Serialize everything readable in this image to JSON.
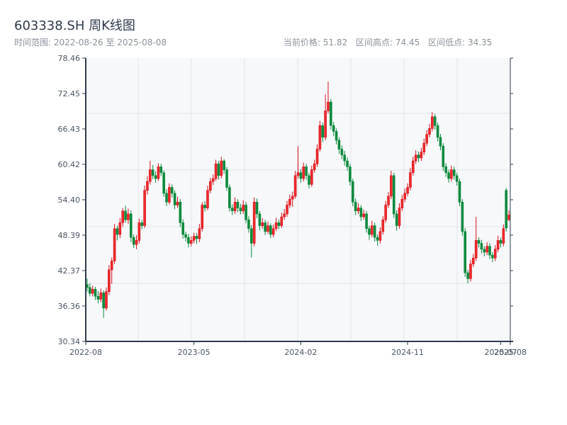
{
  "header": {
    "title": "603338.SH 周K线图",
    "range_label": "时间范围: 2022-08-26 至 2025-08-08",
    "current_price": "当前价格: 51.82",
    "range_high": "区间高点: 74.45",
    "range_low": "区间低点: 34.35"
  },
  "chart_data": {
    "type": "candlestick",
    "title": "603338.SH 周K线图",
    "ylim": [
      30.34,
      78.46
    ],
    "y_ticks": [
      "78.46",
      "72.45",
      "66.43",
      "60.42",
      "54.40",
      "48.39",
      "42.37",
      "36.36",
      "30.34"
    ],
    "x_ticks": [
      {
        "label": "2022-08",
        "date": "2022-08-26"
      },
      {
        "label": "2023-05",
        "date": "2023-05-26"
      },
      {
        "label": "2024-02",
        "date": "2024-02-23"
      },
      {
        "label": "2024-11",
        "date": "2024-11-22"
      },
      {
        "label": "2025-07",
        "date": "2025-07-18"
      },
      {
        "label": "2025-08",
        "date": "2025-08-08"
      }
    ],
    "grid": true,
    "colors": {
      "up": "#d7101c",
      "down": "#0c8a3c",
      "background": "#f6f8fa",
      "axis": "#2f3b4c",
      "grid": "#e2e5ea"
    },
    "columns": [
      "date",
      "open",
      "high",
      "low",
      "close"
    ],
    "candles": [
      [
        "2022-08-26",
        40.0,
        41.0,
        38.8,
        39.5
      ],
      [
        "2022-09-02",
        39.5,
        40.2,
        38.0,
        38.5
      ],
      [
        "2022-09-09",
        38.5,
        39.8,
        38.0,
        39.2
      ],
      [
        "2022-09-16",
        39.2,
        39.6,
        37.4,
        38.0
      ],
      [
        "2022-09-23",
        38.0,
        38.9,
        36.8,
        37.5
      ],
      [
        "2022-09-30",
        37.5,
        39.3,
        37.0,
        38.6
      ],
      [
        "2022-10-07",
        38.6,
        39.0,
        34.35,
        36.0
      ],
      [
        "2022-10-14",
        36.0,
        39.5,
        35.6,
        38.8
      ],
      [
        "2022-10-21",
        38.8,
        43.3,
        38.2,
        42.5
      ],
      [
        "2022-10-28",
        42.5,
        44.6,
        40.1,
        44.0
      ],
      [
        "2022-11-04",
        44.0,
        50.3,
        43.5,
        49.5
      ],
      [
        "2022-11-11",
        49.5,
        50.0,
        47.5,
        48.5
      ],
      [
        "2022-11-18",
        48.5,
        51.3,
        47.9,
        50.5
      ],
      [
        "2022-11-25",
        50.5,
        53.0,
        49.8,
        52.5
      ],
      [
        "2022-12-02",
        52.5,
        53.4,
        50.5,
        51.0
      ],
      [
        "2022-12-09",
        51.0,
        52.9,
        50.3,
        52.0
      ],
      [
        "2022-12-16",
        52.0,
        52.6,
        47.2,
        48.0
      ],
      [
        "2022-12-23",
        48.0,
        48.5,
        46.2,
        46.8
      ],
      [
        "2022-12-30",
        46.8,
        48.4,
        46.0,
        47.5
      ],
      [
        "2023-01-06",
        47.5,
        51.2,
        47.0,
        50.5
      ],
      [
        "2023-01-13",
        50.5,
        51.0,
        49.4,
        50.0
      ],
      [
        "2023-01-20",
        50.0,
        56.8,
        49.6,
        56.0
      ],
      [
        "2023-01-27",
        56.0,
        58.4,
        55.3,
        57.5
      ],
      [
        "2023-02-03",
        57.5,
        61.0,
        57.0,
        59.5
      ],
      [
        "2023-02-10",
        59.5,
        60.3,
        57.9,
        58.5
      ],
      [
        "2023-02-17",
        58.5,
        59.2,
        57.3,
        58.0
      ],
      [
        "2023-02-24",
        58.0,
        60.6,
        57.6,
        60.0
      ],
      [
        "2023-03-03",
        60.0,
        60.5,
        58.4,
        59.0
      ],
      [
        "2023-03-10",
        59.0,
        59.4,
        54.9,
        55.5
      ],
      [
        "2023-03-17",
        55.5,
        56.2,
        53.3,
        54.0
      ],
      [
        "2023-03-24",
        54.0,
        57.2,
        53.6,
        56.5
      ],
      [
        "2023-03-31",
        56.5,
        57.0,
        54.8,
        55.5
      ],
      [
        "2023-04-07",
        55.5,
        56.0,
        52.8,
        53.5
      ],
      [
        "2023-04-14",
        53.5,
        54.9,
        53.0,
        54.0
      ],
      [
        "2023-04-21",
        54.0,
        54.5,
        49.8,
        50.5
      ],
      [
        "2023-04-28",
        50.5,
        51.1,
        47.8,
        48.5
      ],
      [
        "2023-05-05",
        48.5,
        49.0,
        47.3,
        48.0
      ],
      [
        "2023-05-12",
        48.0,
        48.6,
        46.3,
        47.0
      ],
      [
        "2023-05-19",
        47.0,
        48.2,
        46.5,
        47.5
      ],
      [
        "2023-05-26",
        47.5,
        48.8,
        47.0,
        48.2
      ],
      [
        "2023-06-02",
        48.2,
        48.7,
        46.9,
        47.8
      ],
      [
        "2023-06-09",
        47.8,
        50.3,
        47.2,
        49.5
      ],
      [
        "2023-06-16",
        49.5,
        54.0,
        49.0,
        53.5
      ],
      [
        "2023-06-23",
        53.5,
        54.2,
        52.4,
        53.0
      ],
      [
        "2023-06-30",
        53.0,
        56.8,
        52.6,
        56.0
      ],
      [
        "2023-07-07",
        56.0,
        58.1,
        55.5,
        57.5
      ],
      [
        "2023-07-14",
        57.5,
        58.7,
        56.9,
        58.0
      ],
      [
        "2023-07-21",
        58.0,
        61.2,
        57.6,
        60.5
      ],
      [
        "2023-07-28",
        60.5,
        61.0,
        57.8,
        58.5
      ],
      [
        "2023-08-04",
        58.5,
        61.7,
        58.0,
        61.0
      ],
      [
        "2023-08-11",
        61.0,
        61.3,
        58.8,
        59.5
      ],
      [
        "2023-08-18",
        59.5,
        60.0,
        55.9,
        56.5
      ],
      [
        "2023-08-25",
        56.5,
        57.0,
        52.4,
        53.0
      ],
      [
        "2023-09-01",
        53.0,
        53.6,
        51.8,
        52.5
      ],
      [
        "2023-09-08",
        52.5,
        54.8,
        52.0,
        54.0
      ],
      [
        "2023-09-15",
        54.0,
        54.5,
        52.3,
        53.0
      ],
      [
        "2023-09-22",
        53.0,
        53.7,
        51.9,
        52.5
      ],
      [
        "2023-09-29",
        52.5,
        54.3,
        52.0,
        53.5
      ],
      [
        "2023-10-06",
        53.5,
        54.0,
        50.4,
        51.0
      ],
      [
        "2023-10-13",
        51.0,
        51.6,
        48.8,
        49.5
      ],
      [
        "2023-10-20",
        49.5,
        50.1,
        44.6,
        47.0
      ],
      [
        "2023-10-27",
        47.0,
        54.8,
        46.5,
        54.0
      ],
      [
        "2023-11-03",
        54.0,
        54.6,
        51.3,
        52.0
      ],
      [
        "2023-11-10",
        52.0,
        52.5,
        49.2,
        50.0
      ],
      [
        "2023-11-17",
        50.0,
        51.3,
        49.5,
        50.5
      ],
      [
        "2023-11-24",
        50.5,
        51.0,
        48.4,
        49.0
      ],
      [
        "2023-12-01",
        49.0,
        50.7,
        48.6,
        50.0
      ],
      [
        "2023-12-08",
        50.0,
        50.4,
        47.9,
        48.5
      ],
      [
        "2023-12-15",
        48.5,
        50.2,
        48.0,
        49.5
      ],
      [
        "2023-12-22",
        49.5,
        51.3,
        49.1,
        50.5
      ],
      [
        "2023-12-29",
        50.5,
        51.0,
        49.4,
        50.0
      ],
      [
        "2024-01-05",
        50.0,
        52.2,
        49.6,
        51.5
      ],
      [
        "2024-01-12",
        51.5,
        52.8,
        51.0,
        52.0
      ],
      [
        "2024-01-19",
        52.0,
        54.2,
        51.5,
        53.5
      ],
      [
        "2024-01-26",
        53.5,
        55.3,
        53.0,
        54.5
      ],
      [
        "2024-02-02",
        54.5,
        55.8,
        53.2,
        55.0
      ],
      [
        "2024-02-09",
        55.0,
        59.3,
        54.6,
        58.5
      ],
      [
        "2024-02-16",
        58.5,
        63.5,
        58.0,
        59.0
      ],
      [
        "2024-02-23",
        59.0,
        59.6,
        57.3,
        58.0
      ],
      [
        "2024-03-01",
        58.0,
        60.7,
        57.5,
        60.0
      ],
      [
        "2024-03-08",
        60.0,
        60.5,
        57.8,
        58.5
      ],
      [
        "2024-03-15",
        58.5,
        59.0,
        56.3,
        57.0
      ],
      [
        "2024-03-22",
        57.0,
        60.2,
        56.6,
        59.5
      ],
      [
        "2024-03-29",
        59.5,
        61.2,
        59.0,
        60.5
      ],
      [
        "2024-04-05",
        60.5,
        63.8,
        60.0,
        63.0
      ],
      [
        "2024-04-12",
        63.0,
        67.8,
        62.6,
        67.0
      ],
      [
        "2024-04-19",
        67.0,
        67.5,
        64.2,
        65.0
      ],
      [
        "2024-04-26",
        65.0,
        72.3,
        64.5,
        69.5
      ],
      [
        "2024-05-03",
        69.5,
        74.45,
        69.0,
        71.0
      ],
      [
        "2024-05-10",
        71.0,
        71.5,
        66.3,
        67.0
      ],
      [
        "2024-05-17",
        67.0,
        67.6,
        65.2,
        66.0
      ],
      [
        "2024-05-24",
        66.0,
        66.5,
        63.8,
        64.5
      ],
      [
        "2024-05-31",
        64.5,
        65.0,
        62.2,
        63.0
      ],
      [
        "2024-06-07",
        63.0,
        63.6,
        61.3,
        62.0
      ],
      [
        "2024-06-14",
        62.0,
        62.7,
        60.2,
        61.0
      ],
      [
        "2024-06-21",
        61.0,
        61.6,
        59.3,
        60.0
      ],
      [
        "2024-06-28",
        60.0,
        60.5,
        56.8,
        57.5
      ],
      [
        "2024-07-05",
        57.5,
        58.0,
        53.3,
        54.0
      ],
      [
        "2024-07-12",
        54.0,
        54.6,
        51.8,
        52.5
      ],
      [
        "2024-07-19",
        52.5,
        53.8,
        52.0,
        53.0
      ],
      [
        "2024-07-26",
        53.0,
        53.5,
        50.8,
        51.5
      ],
      [
        "2024-08-02",
        51.5,
        52.7,
        51.0,
        52.0
      ],
      [
        "2024-08-09",
        52.0,
        52.5,
        48.8,
        49.5
      ],
      [
        "2024-08-16",
        49.5,
        50.0,
        47.6,
        48.5
      ],
      [
        "2024-08-23",
        48.5,
        50.8,
        48.0,
        50.0
      ],
      [
        "2024-08-30",
        50.0,
        50.5,
        47.3,
        48.0
      ],
      [
        "2024-09-06",
        48.0,
        48.5,
        46.6,
        47.5
      ],
      [
        "2024-09-13",
        47.5,
        49.7,
        47.0,
        49.0
      ],
      [
        "2024-09-20",
        49.0,
        51.6,
        48.5,
        51.0
      ],
      [
        "2024-09-27",
        51.0,
        54.2,
        50.5,
        53.5
      ],
      [
        "2024-10-04",
        53.5,
        55.7,
        53.0,
        55.0
      ],
      [
        "2024-10-11",
        55.0,
        59.3,
        54.5,
        58.5
      ],
      [
        "2024-10-18",
        58.5,
        59.0,
        51.3,
        52.0
      ],
      [
        "2024-10-25",
        52.0,
        52.6,
        49.2,
        50.0
      ],
      [
        "2024-11-01",
        50.0,
        53.8,
        49.5,
        53.0
      ],
      [
        "2024-11-08",
        53.0,
        55.2,
        52.5,
        54.5
      ],
      [
        "2024-11-15",
        54.5,
        56.3,
        54.0,
        55.5
      ],
      [
        "2024-11-22",
        55.5,
        57.2,
        55.0,
        56.5
      ],
      [
        "2024-11-29",
        56.5,
        59.8,
        56.0,
        59.0
      ],
      [
        "2024-12-06",
        59.0,
        61.7,
        58.5,
        61.0
      ],
      [
        "2024-12-13",
        61.0,
        62.8,
        60.5,
        62.0
      ],
      [
        "2024-12-20",
        62.0,
        62.6,
        60.8,
        61.5
      ],
      [
        "2024-12-27",
        61.5,
        63.2,
        61.0,
        62.5
      ],
      [
        "2025-01-03",
        62.5,
        64.8,
        62.0,
        64.0
      ],
      [
        "2025-01-10",
        64.0,
        66.2,
        63.5,
        65.5
      ],
      [
        "2025-01-17",
        65.5,
        67.3,
        65.0,
        66.5
      ],
      [
        "2025-01-24",
        66.5,
        69.3,
        66.0,
        68.5
      ],
      [
        "2025-01-31",
        68.5,
        69.0,
        66.3,
        67.0
      ],
      [
        "2025-02-07",
        67.0,
        67.5,
        64.3,
        65.0
      ],
      [
        "2025-02-14",
        65.0,
        65.6,
        62.8,
        63.5
      ],
      [
        "2025-02-21",
        63.5,
        64.0,
        59.3,
        60.0
      ],
      [
        "2025-02-28",
        60.0,
        60.6,
        58.3,
        59.0
      ],
      [
        "2025-03-07",
        59.0,
        59.5,
        57.3,
        58.0
      ],
      [
        "2025-03-14",
        58.0,
        60.2,
        57.5,
        59.5
      ],
      [
        "2025-03-21",
        59.5,
        60.0,
        57.8,
        58.5
      ],
      [
        "2025-03-28",
        58.5,
        59.0,
        56.8,
        57.5
      ],
      [
        "2025-04-04",
        57.5,
        58.0,
        53.3,
        54.0
      ],
      [
        "2025-04-11",
        54.0,
        54.5,
        48.3,
        49.0
      ],
      [
        "2025-04-18",
        49.0,
        49.6,
        41.3,
        42.0
      ],
      [
        "2025-04-25",
        42.0,
        42.5,
        40.2,
        41.0
      ],
      [
        "2025-05-02",
        41.0,
        44.2,
        40.5,
        43.5
      ],
      [
        "2025-05-09",
        43.5,
        45.2,
        43.0,
        44.5
      ],
      [
        "2025-05-16",
        44.5,
        51.5,
        44.0,
        47.5
      ],
      [
        "2025-05-23",
        47.5,
        48.0,
        46.3,
        47.0
      ],
      [
        "2025-05-30",
        47.0,
        47.6,
        45.3,
        46.0
      ],
      [
        "2025-06-06",
        46.0,
        46.5,
        44.8,
        45.5
      ],
      [
        "2025-06-13",
        45.5,
        47.2,
        45.0,
        46.5
      ],
      [
        "2025-06-20",
        46.5,
        47.0,
        44.3,
        45.0
      ],
      [
        "2025-06-27",
        45.0,
        45.5,
        43.8,
        44.5
      ],
      [
        "2025-07-04",
        44.5,
        46.7,
        44.0,
        46.0
      ],
      [
        "2025-07-11",
        46.0,
        48.3,
        45.5,
        47.5
      ],
      [
        "2025-07-18",
        47.5,
        48.0,
        46.3,
        47.0
      ],
      [
        "2025-07-25",
        47.0,
        50.2,
        46.5,
        49.5
      ],
      [
        "2025-08-01",
        56.0,
        56.4,
        49.0,
        49.6
      ],
      [
        "2025-08-08",
        51.0,
        52.6,
        50.8,
        51.82
      ]
    ]
  }
}
